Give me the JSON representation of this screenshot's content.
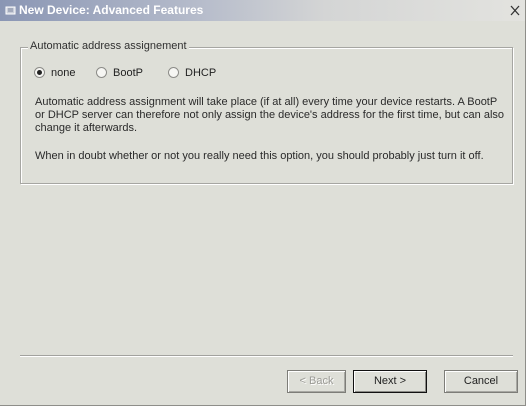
{
  "window": {
    "title": "New Device: Advanced Features",
    "title_icon": "device-app-icon",
    "close_icon": "close-icon"
  },
  "address_group": {
    "legend": "Automatic address assignement",
    "options": [
      {
        "label": "none",
        "selected": true
      },
      {
        "label": "BootP",
        "selected": false
      },
      {
        "label": "DHCP",
        "selected": false
      }
    ],
    "description": "Automatic address assignment will take place (if at all) every time your device restarts. A BootP or DHCP server can therefore not only assign the device's address for the first time, but can also change it afterwards.",
    "advice": "When in doubt whether or not you really need this option, you should probably just turn it off."
  },
  "buttons": {
    "back": {
      "label": "< Back",
      "enabled": false
    },
    "next": {
      "label": "Next >",
      "enabled": true,
      "default": true
    },
    "cancel": {
      "label": "Cancel",
      "enabled": true
    }
  },
  "colors": {
    "dialog_background": "#dedfd8",
    "titlebar_start": "#8a96b4",
    "titlebar_end": "#e3e3df"
  }
}
